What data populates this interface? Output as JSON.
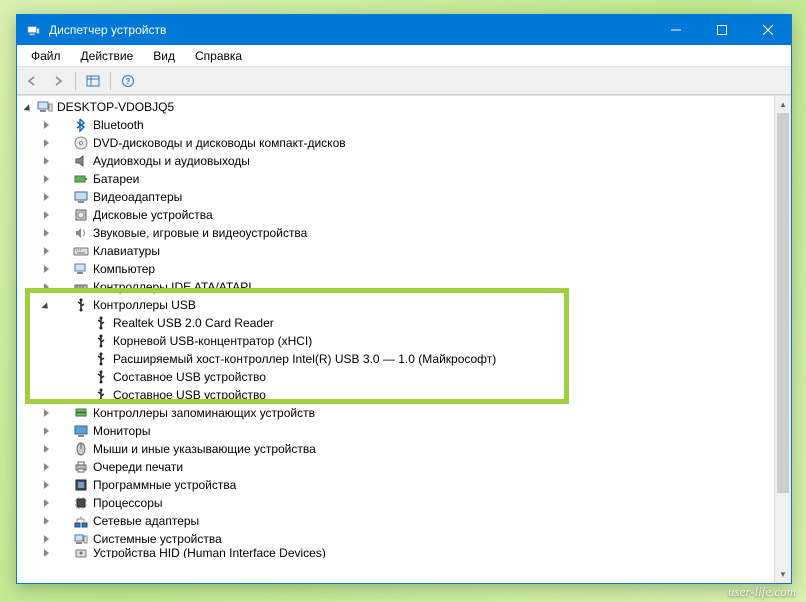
{
  "titlebar": {
    "title": "Диспетчер устройств"
  },
  "menu": {
    "file": "Файл",
    "action": "Действие",
    "view": "Вид",
    "help": "Справка"
  },
  "root": {
    "label": "DESKTOP-VDOBJQ5"
  },
  "categories": [
    {
      "label": "Bluetooth",
      "icon": "bluetooth",
      "expanded": false
    },
    {
      "label": "DVD-дисководы и дисководы компакт-дисков",
      "icon": "disc",
      "expanded": false
    },
    {
      "label": "Аудиовходы и аудиовыходы",
      "icon": "audio",
      "expanded": false
    },
    {
      "label": "Батареи",
      "icon": "battery",
      "expanded": false
    },
    {
      "label": "Видеоадаптеры",
      "icon": "display",
      "expanded": false
    },
    {
      "label": "Дисковые устройства",
      "icon": "disk",
      "expanded": false
    },
    {
      "label": "Звуковые, игровые и видеоустройства",
      "icon": "sound",
      "expanded": false
    },
    {
      "label": "Клавиатуры",
      "icon": "keyboard",
      "expanded": false
    },
    {
      "label": "Компьютер",
      "icon": "computer",
      "expanded": false
    },
    {
      "label": "Контроллеры IDE ATA/ATAPI",
      "icon": "ide",
      "expanded": false,
      "truncated": true
    },
    {
      "label": "Контроллеры USB",
      "icon": "usb",
      "expanded": true,
      "highlighted": true,
      "children": [
        {
          "label": "Realtek USB 2.0 Card Reader",
          "icon": "usb-device"
        },
        {
          "label": "Корневой USB-концентратор (xHCI)",
          "icon": "usb-device"
        },
        {
          "label": "Расширяемый хост-контроллер Intel(R) USB 3.0 — 1.0 (Майкрософт)",
          "icon": "usb-device"
        },
        {
          "label": "Составное USB устройство",
          "icon": "usb-device"
        },
        {
          "label": "Составное USB устройство",
          "icon": "usb-device"
        }
      ]
    },
    {
      "label": "Контроллеры запоминающих устройств",
      "icon": "storage",
      "expanded": false
    },
    {
      "label": "Мониторы",
      "icon": "monitor",
      "expanded": false
    },
    {
      "label": "Мыши и иные указывающие устройства",
      "icon": "mouse",
      "expanded": false
    },
    {
      "label": "Очереди печати",
      "icon": "printer",
      "expanded": false
    },
    {
      "label": "Программные устройства",
      "icon": "software",
      "expanded": false
    },
    {
      "label": "Процессоры",
      "icon": "cpu",
      "expanded": false
    },
    {
      "label": "Сетевые адаптеры",
      "icon": "network",
      "expanded": false
    },
    {
      "label": "Системные устройства",
      "icon": "system",
      "expanded": false
    },
    {
      "label": "Устройства HID (Human Interface Devices)",
      "icon": "hid",
      "expanded": false,
      "cut": true
    }
  ],
  "watermark": "user-life.com"
}
